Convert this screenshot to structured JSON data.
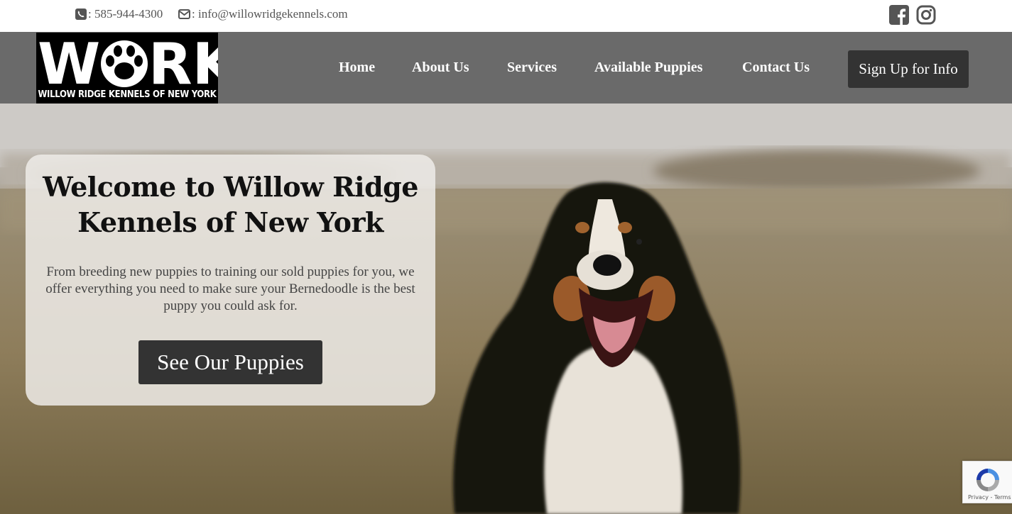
{
  "contact": {
    "phone": ": 585-944-4300",
    "email": ": info@willowridgekennels.com",
    "phone_icon": "phone-square-icon",
    "email_icon": "envelope-icon"
  },
  "social": {
    "facebook_icon": "facebook-icon",
    "instagram_icon": "instagram-icon"
  },
  "logo": {
    "letters": "WRK",
    "subtitle": "WILLOW RIDGE KENNELS OF NEW YORK"
  },
  "nav": {
    "items": [
      {
        "label": "Home"
      },
      {
        "label": "About Us"
      },
      {
        "label": "Services"
      },
      {
        "label": "Available Puppies"
      },
      {
        "label": "Contact Us"
      }
    ],
    "signup_label": "Sign Up for Info"
  },
  "hero": {
    "title": "Welcome to Willow Ridge Kennels of New York",
    "description": "From breeding new puppies to training our sold puppies for you, we offer everything you need to make sure your Bernedoodle is the best puppy you could ask for.",
    "cta_label": "See Our Puppies"
  },
  "recaptcha": {
    "links": "Privacy - Terms"
  },
  "colors": {
    "navbar": "#6a6a6a",
    "button": "#333333",
    "contact_text": "#555555"
  }
}
